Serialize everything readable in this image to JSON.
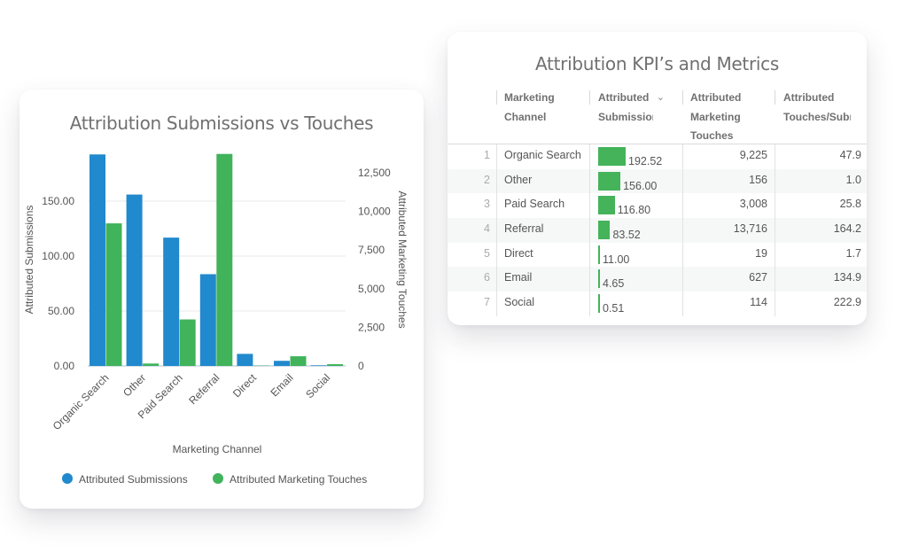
{
  "chart_card": {
    "title": "Attribution Submissions vs Touches"
  },
  "chart_data": {
    "type": "bar",
    "title": "Attribution Submissions vs Touches",
    "categories": [
      "Organic Search",
      "Other",
      "Paid Search",
      "Referral",
      "Direct",
      "Email",
      "Social"
    ],
    "series": [
      {
        "name": "Attributed Submissions",
        "axis": "left",
        "color": "#2189cd",
        "values": [
          192.52,
          156.0,
          116.8,
          83.52,
          11.0,
          4.65,
          0.51
        ]
      },
      {
        "name": "Attributed Marketing Touches",
        "axis": "right",
        "color": "#41b35b",
        "values": [
          9225,
          156,
          3008,
          13716,
          19,
          627,
          114
        ]
      }
    ],
    "xlabel": "Marketing Channel",
    "ylabel": "Attributed Submissions",
    "y2label": "Attributed Marketing Touches",
    "yticks": [
      "0.00",
      "50.00",
      "100.00",
      "150.00"
    ],
    "ytick_values": [
      0,
      50,
      100,
      150
    ],
    "y2ticks": [
      "0",
      "2,500",
      "5,000",
      "7,500",
      "10,000",
      "12,500"
    ],
    "y2tick_values": [
      0,
      2500,
      5000,
      7500,
      10000,
      12500
    ],
    "ylim": [
      0,
      192.52
    ],
    "y2lim": [
      0,
      13716
    ],
    "grid": true,
    "legend_position": "bottom"
  },
  "table_card": {
    "title": "Attribution KPI’s and Metrics",
    "columns": [
      {
        "label": "Marketing Channel"
      },
      {
        "label": "Attributed Submissions",
        "sort": "descending"
      },
      {
        "label": "Attributed Marketing Touches"
      },
      {
        "label": "Attributed Touches/Submission"
      }
    ],
    "bar_max": 192.52,
    "bar_color": "#44b35a",
    "rows": [
      {
        "num": "1",
        "channel": "Organic Search",
        "submissions": "192.52",
        "sub_value": 192.52,
        "touches": "9,225",
        "ratio": "47.9"
      },
      {
        "num": "2",
        "channel": "Other",
        "submissions": "156.00",
        "sub_value": 156.0,
        "touches": "156",
        "ratio": "1.0"
      },
      {
        "num": "3",
        "channel": "Paid Search",
        "submissions": "116.80",
        "sub_value": 116.8,
        "touches": "3,008",
        "ratio": "25.8"
      },
      {
        "num": "4",
        "channel": "Referral",
        "submissions": "83.52",
        "sub_value": 83.52,
        "touches": "13,716",
        "ratio": "164.2"
      },
      {
        "num": "5",
        "channel": "Direct",
        "submissions": "11.00",
        "sub_value": 11.0,
        "touches": "19",
        "ratio": "1.7"
      },
      {
        "num": "6",
        "channel": "Email",
        "submissions": "4.65",
        "sub_value": 4.65,
        "touches": "627",
        "ratio": "134.9"
      },
      {
        "num": "7",
        "channel": "Social",
        "submissions": "0.51",
        "sub_value": 0.51,
        "touches": "114",
        "ratio": "222.9"
      }
    ]
  }
}
